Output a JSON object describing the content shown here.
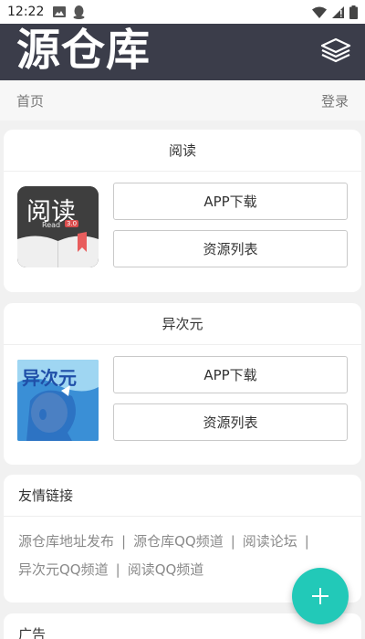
{
  "status_bar": {
    "time": "12:22"
  },
  "header": {
    "title": "源仓库"
  },
  "nav": {
    "home": "首页",
    "login": "登录"
  },
  "cards": [
    {
      "title": "阅读",
      "icon_text": "阅读",
      "icon_sub": "Read",
      "icon_version": "3.0",
      "download_label": "APP下载",
      "resources_label": "资源列表"
    },
    {
      "title": "异次元",
      "icon_text": "异次元",
      "download_label": "APP下载",
      "resources_label": "资源列表"
    }
  ],
  "friends": {
    "title": "友情链接",
    "links": [
      "源仓库地址发布",
      "源仓库QQ频道",
      "阅读论坛",
      "异次元QQ频道",
      "阅读QQ频道"
    ],
    "separator": "|"
  },
  "ad": {
    "title": "广告"
  },
  "colors": {
    "header_bg": "#3b3d4a",
    "fab": "#22c9b8"
  }
}
